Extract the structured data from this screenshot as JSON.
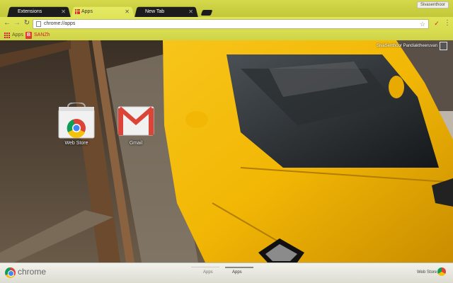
{
  "tabs": [
    {
      "label": "Extensions",
      "active": false
    },
    {
      "label": "Apps",
      "active": true
    },
    {
      "label": "New Tab",
      "active": false
    }
  ],
  "profile_badge": "Sivasenthoor",
  "toolbar": {
    "url": "chrome://apps"
  },
  "bookmarks": {
    "apps_label": "Apps",
    "items": [
      {
        "label": "SANZh",
        "icon": "bookmark-app-icon"
      }
    ]
  },
  "content": {
    "user_name": "SivaSenthoor Pandiaktheeruvan",
    "apps": [
      {
        "label": "Web Store",
        "icon": "chrome-webstore-icon"
      },
      {
        "label": "Gmail",
        "icon": "gmail-icon"
      }
    ]
  },
  "footer": {
    "brand": "chrome",
    "pages": [
      "Apps",
      "Apps"
    ],
    "webstore_label": "Web Store"
  },
  "colors": {
    "theme_accent": "#d4d84a",
    "car_yellow": "#f2b705"
  }
}
